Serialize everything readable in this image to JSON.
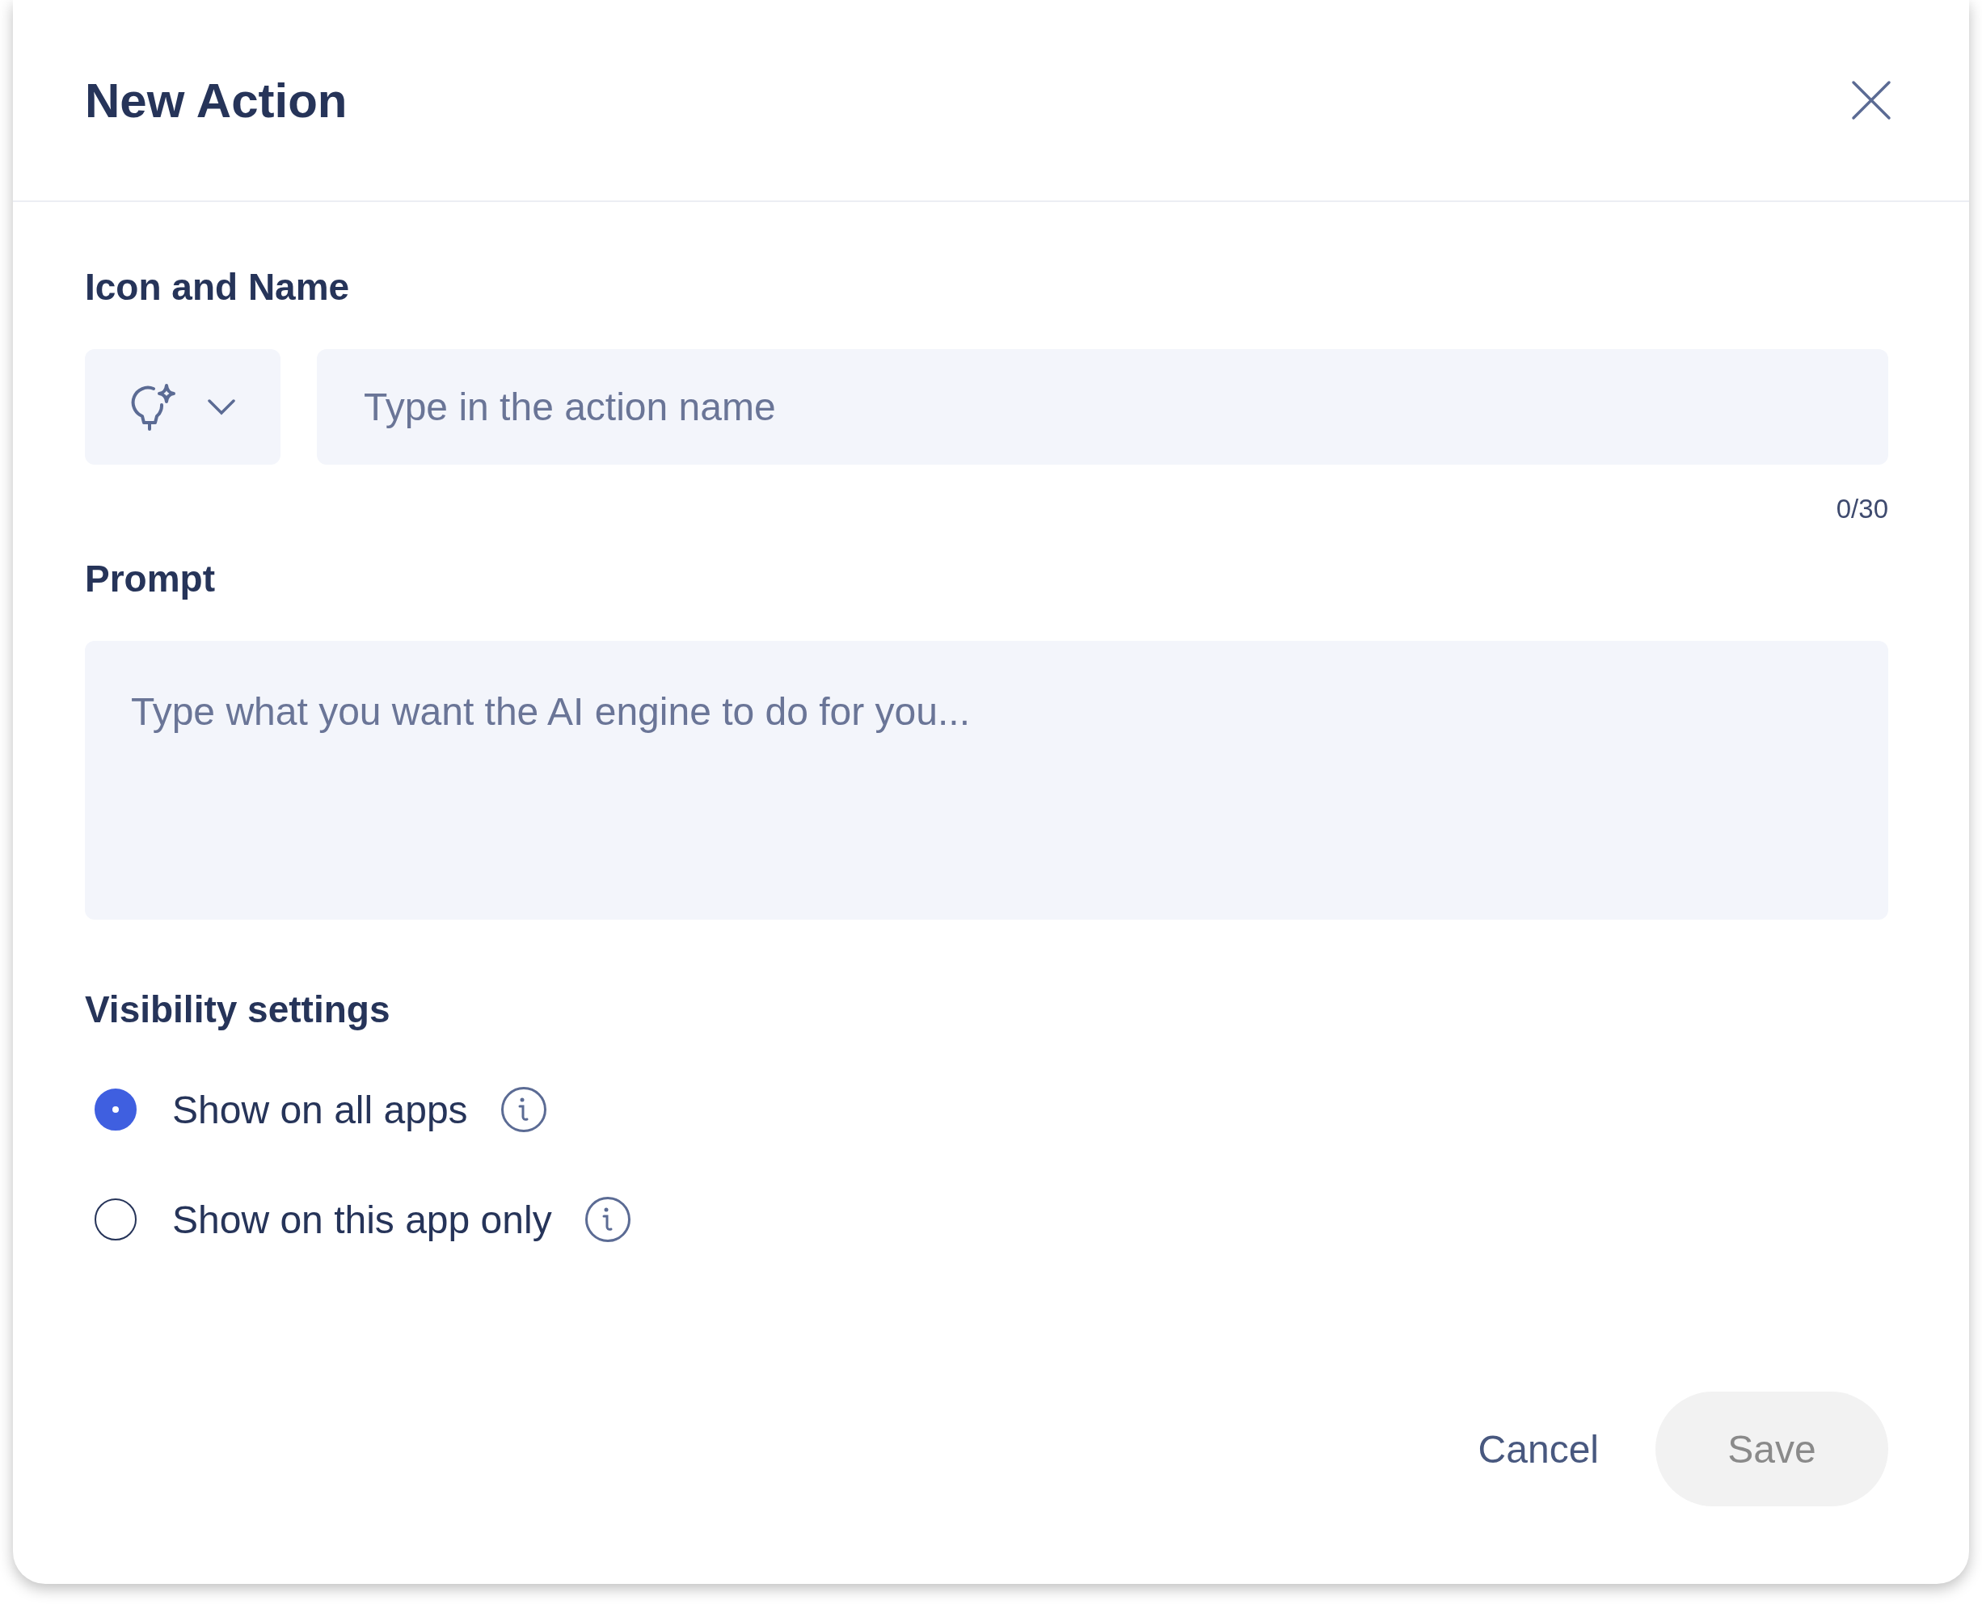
{
  "dialog": {
    "title": "New Action"
  },
  "icon_and_name": {
    "label": "Icon and Name",
    "name_field": {
      "placeholder": "Type in the action name"
    },
    "counter": "0/30"
  },
  "prompt": {
    "label": "Prompt",
    "placeholder": "Type what you want the AI engine to do for you..."
  },
  "visibility": {
    "label": "Visibility settings",
    "options": [
      {
        "label": "Show on all apps",
        "selected": true
      },
      {
        "label": "Show on this app only",
        "selected": false
      }
    ]
  },
  "buttons": {
    "cancel": "Cancel",
    "save": {
      "label": "Save",
      "disabled": true
    }
  }
}
